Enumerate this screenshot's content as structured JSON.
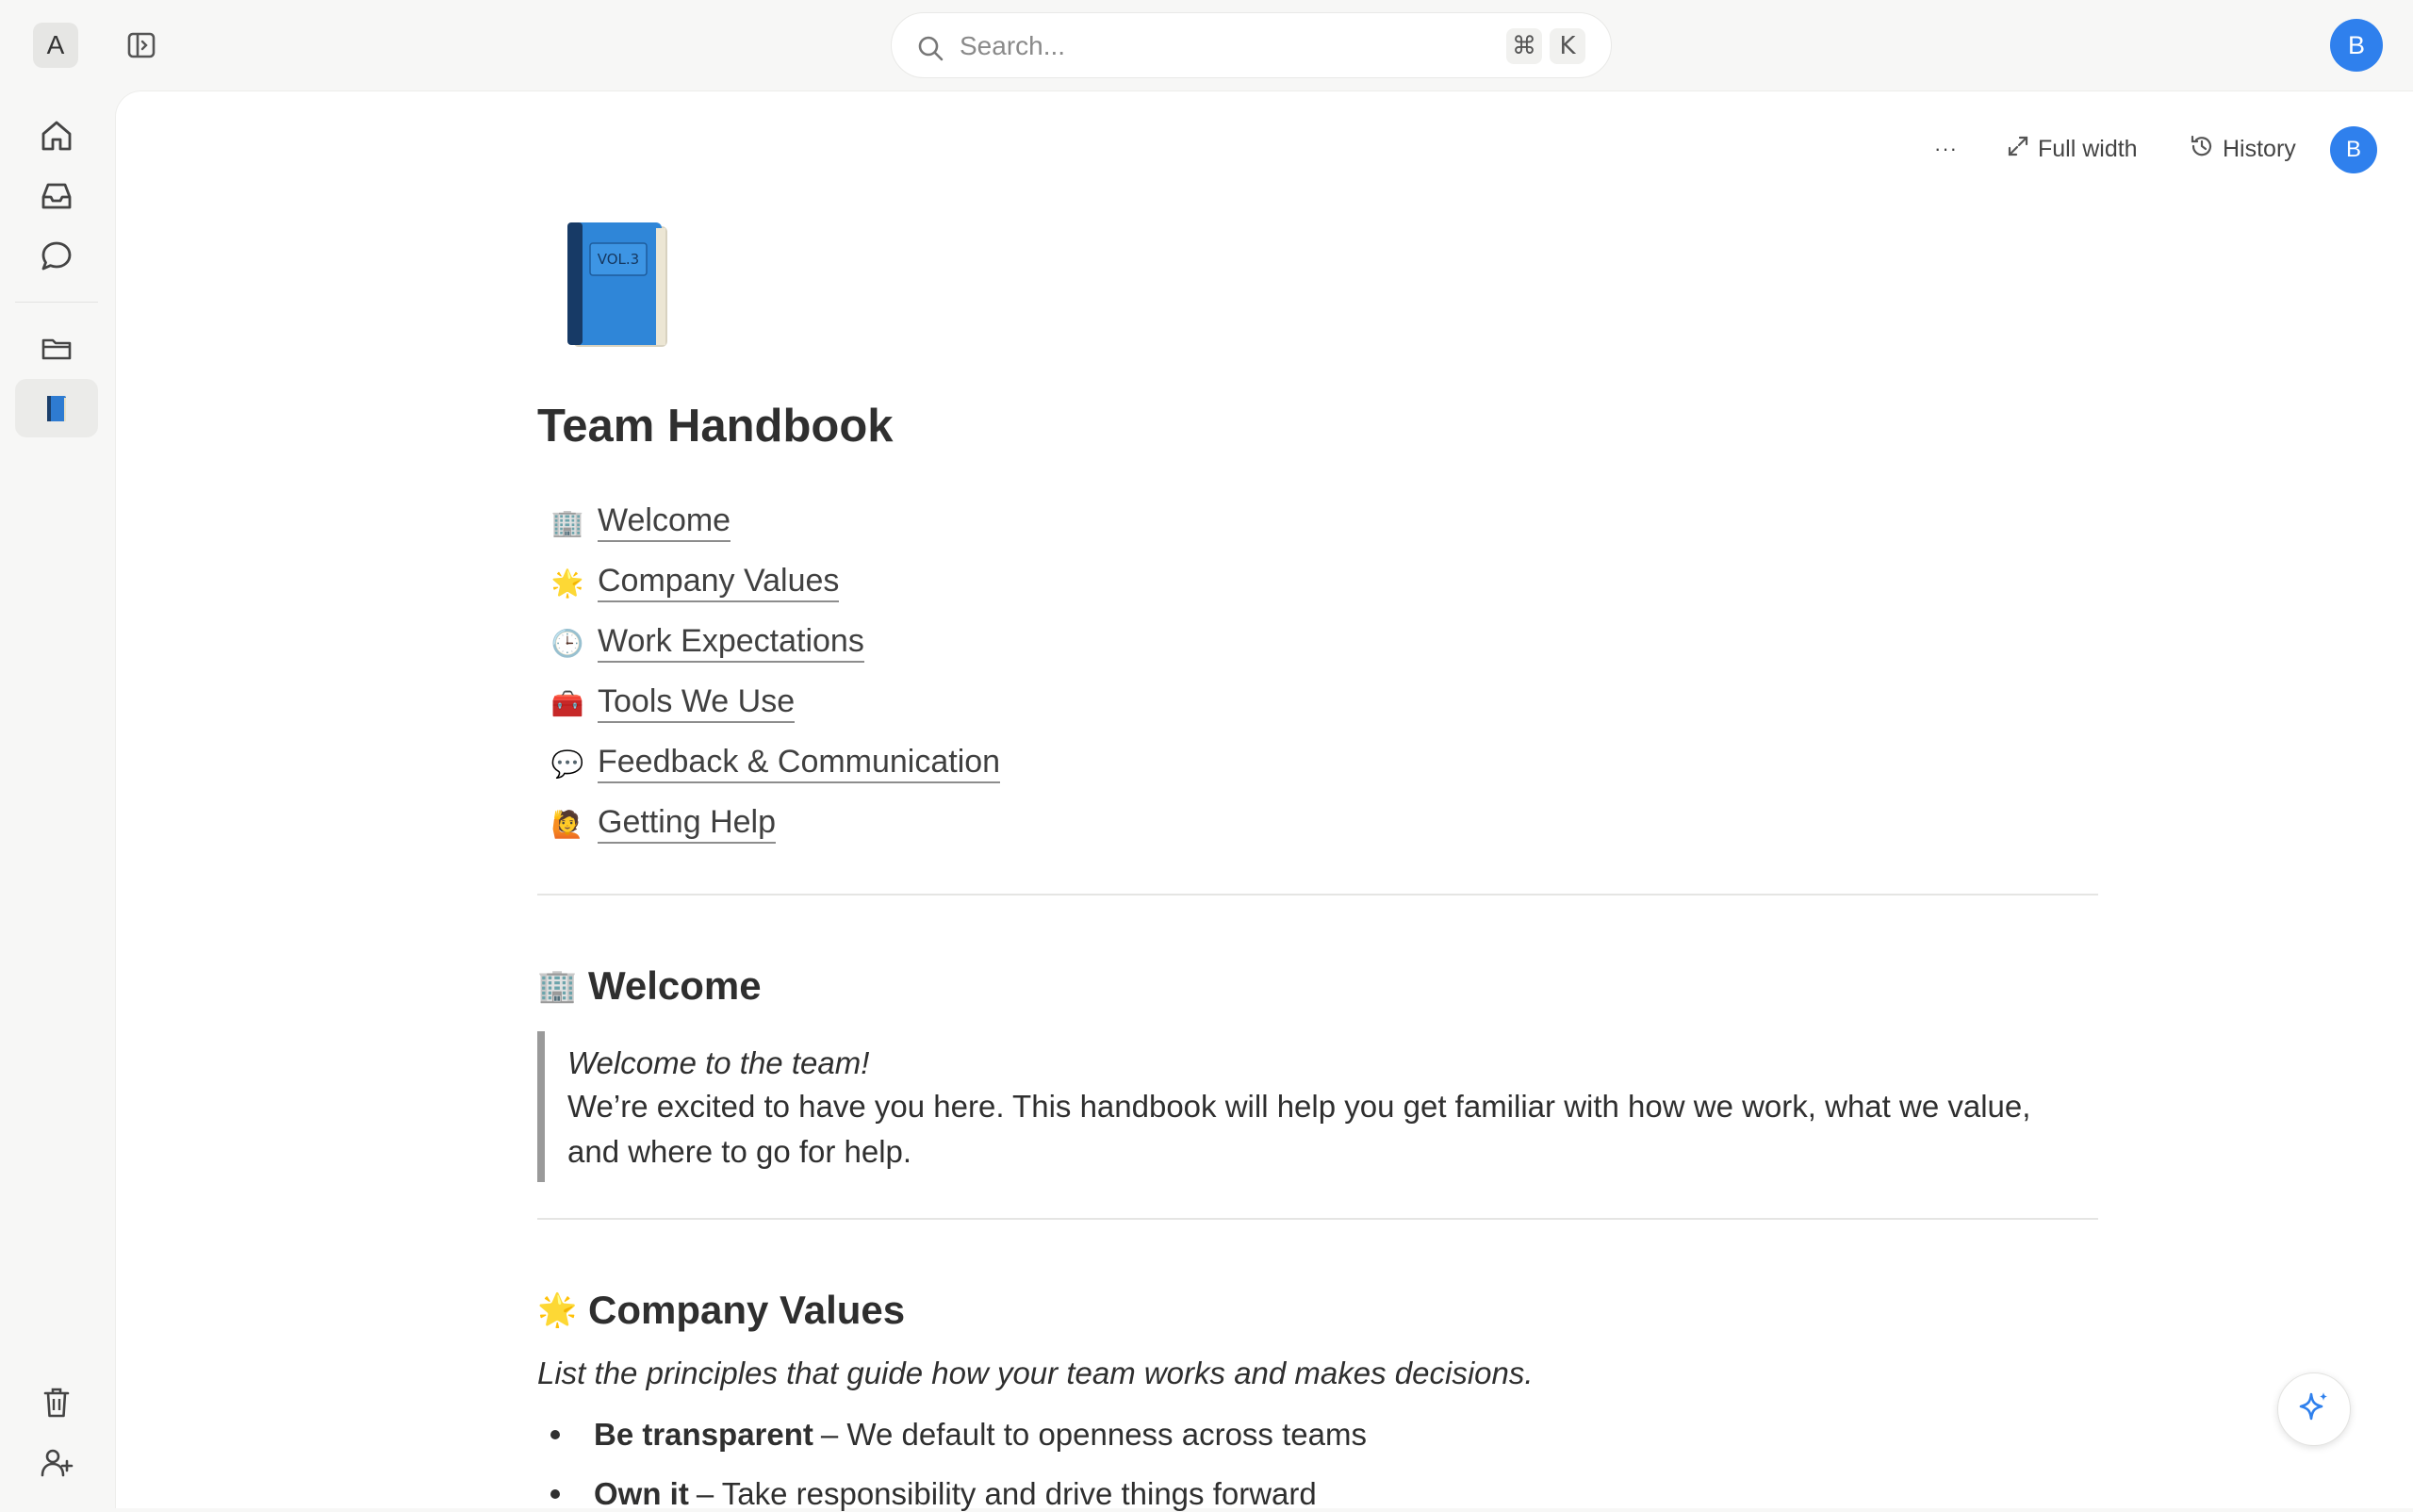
{
  "workspace": {
    "initial": "A"
  },
  "search": {
    "placeholder": "Search...",
    "shortcut_modifier": "⌘",
    "shortcut_key": "K"
  },
  "user": {
    "initial": "B",
    "avatar_color": "#2f80ed"
  },
  "toolbar": {
    "more_label": "···",
    "full_width_label": "Full width",
    "history_label": "History"
  },
  "rail": {
    "icons": [
      "home-icon",
      "inbox-icon",
      "chat-icon",
      "folder-icon",
      "book-icon",
      "trash-icon",
      "add-user-icon"
    ],
    "active": "book-icon"
  },
  "document": {
    "icon": "📘",
    "title": "Team Handbook",
    "toc": [
      {
        "emoji": "🏢",
        "label": "Welcome"
      },
      {
        "emoji": "🌟",
        "label": "Company Values"
      },
      {
        "emoji": "🕒",
        "label": "Work Expectations"
      },
      {
        "emoji": "🧰",
        "label": "Tools We Use"
      },
      {
        "emoji": "💬",
        "label": "Feedback & Communication"
      },
      {
        "emoji": "🙋",
        "label": "Getting Help"
      }
    ],
    "welcome": {
      "emoji": "🏢",
      "heading": "Welcome",
      "quote_line1": "Welcome to the team!",
      "quote_line2": "We’re excited to have you here. This handbook will help you get familiar with how we work, what we value, and where to go for help."
    },
    "values": {
      "emoji": "🌟",
      "heading": "Company Values",
      "subtitle": "List the principles that guide how your team works and makes decisions.",
      "bullets": [
        {
          "bold": "Be transparent",
          "text": "– We default to openness across teams"
        },
        {
          "bold": "Own it",
          "text": "– Take responsibility and drive things forward"
        }
      ]
    }
  },
  "colors": {
    "accent": "#2f80ed",
    "background": "#f7f7f6",
    "panel": "#ffffff"
  }
}
